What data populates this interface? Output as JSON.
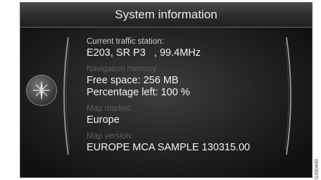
{
  "header": {
    "title": "System information"
  },
  "sections": [
    {
      "label": "Current traffic station:",
      "label_dim": false,
      "values": [
        "E203, SR P3   , 99.4MHz"
      ]
    },
    {
      "label": "Navigation memory",
      "label_dim": true,
      "values": [
        "Free space: 256 MB",
        "Percentage left: 100 %"
      ]
    },
    {
      "label": "Map market:",
      "label_dim": true,
      "values": [
        "Europe"
      ]
    },
    {
      "label": "Map version:",
      "label_dim": true,
      "values": [
        "EUROPE MCA SAMPLE 130315.00"
      ]
    }
  ],
  "footer_code": "G050490",
  "icons": {
    "compass": "compass-icon"
  },
  "colors": {
    "background": "#0c0c0c",
    "text": "#f4f4f4",
    "label_dim": "#5e5e5e"
  }
}
